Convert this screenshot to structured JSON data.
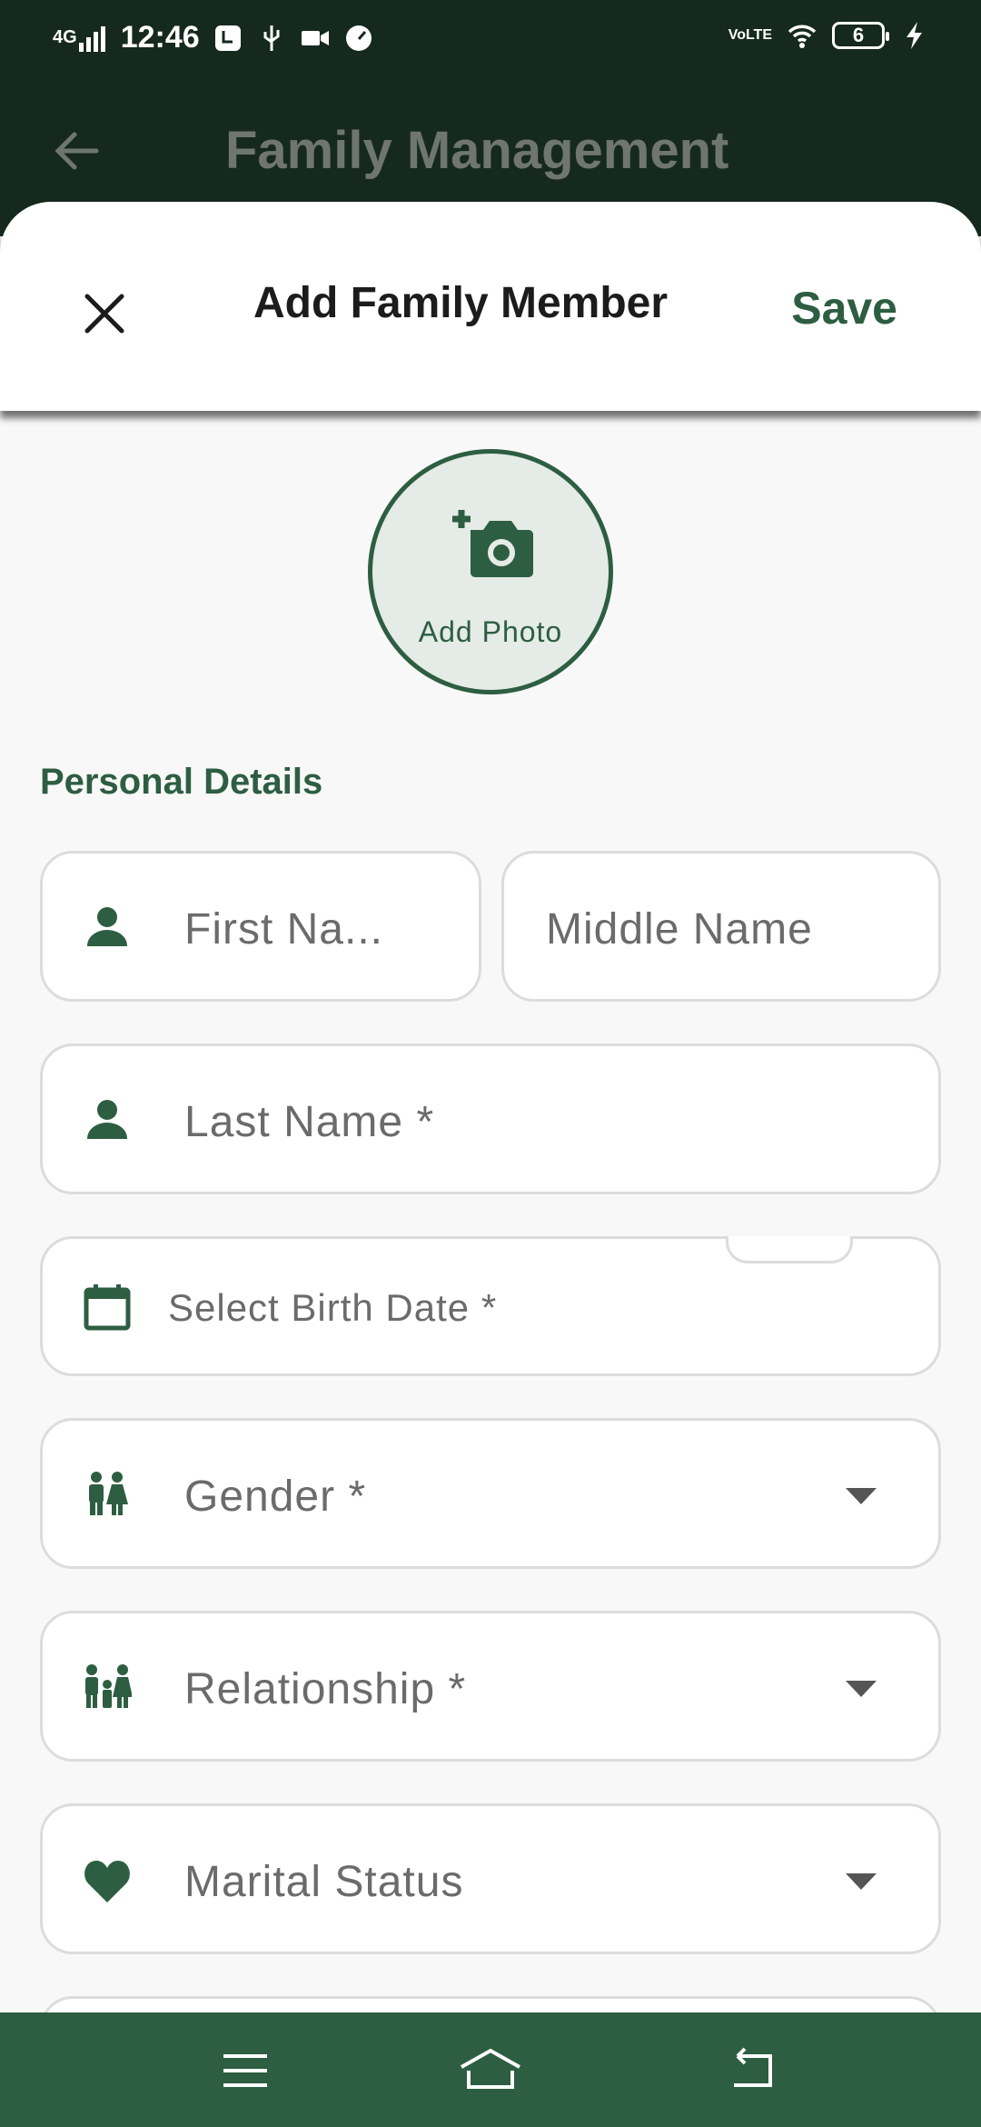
{
  "status_bar": {
    "network": "4G",
    "time": "12:46",
    "volte": "VoLTE",
    "battery": "6"
  },
  "app_bar": {
    "title": "Family Management"
  },
  "sheet": {
    "title": "Add Family Member",
    "save_label": "Save"
  },
  "photo": {
    "label": "Add Photo"
  },
  "section": {
    "personal_details": "Personal Details"
  },
  "fields": {
    "first_name": "First Na...",
    "middle_name": "Middle Name",
    "last_name": "Last Name *",
    "birth_date": "Select Birth Date *",
    "gender": "Gender *",
    "relationship": "Relationship *",
    "marital_status": "Marital Status"
  },
  "colors": {
    "primary": "#2d5e41",
    "app_bar_dim": "#16291f",
    "field_border": "#dcdcdc",
    "background": "#f8f8f8"
  }
}
